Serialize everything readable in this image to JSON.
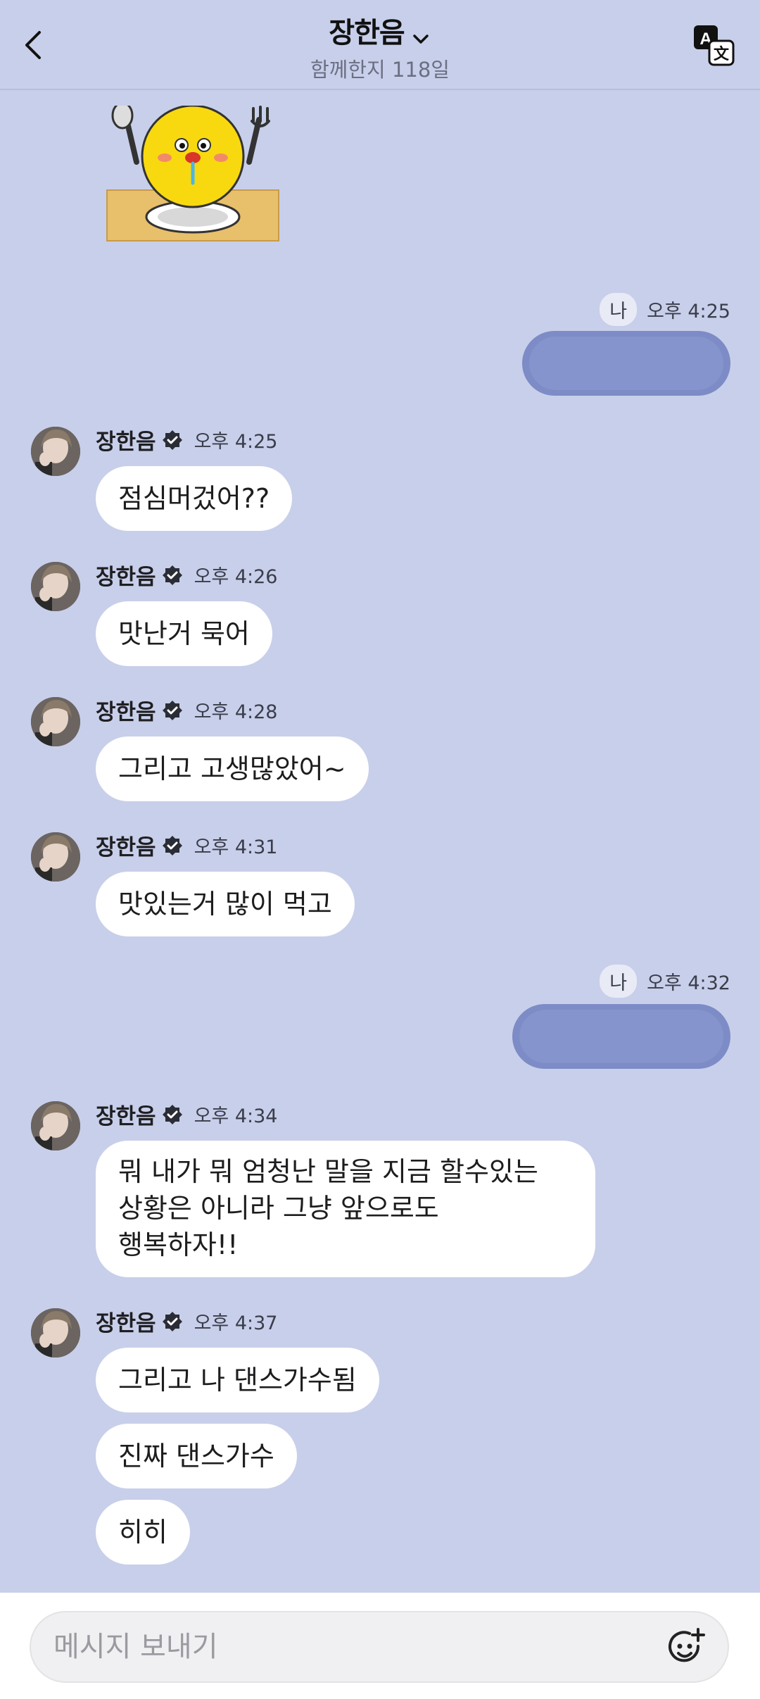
{
  "header": {
    "title": "장한음",
    "subtitle": "함께한지 118일"
  },
  "sticker": {
    "name": "hungry-chick-sticker"
  },
  "my_messages": [
    {
      "badge": "나",
      "time": "오후 4:25",
      "content": "hidden"
    },
    {
      "badge": "나",
      "time": "오후 4:32",
      "content": "hidden"
    }
  ],
  "incoming": [
    {
      "sender": "장한음",
      "time": "오후 4:25",
      "bubbles": [
        "점심머겄어??"
      ]
    },
    {
      "sender": "장한음",
      "time": "오후 4:26",
      "bubbles": [
        "맛난거 묵어"
      ]
    },
    {
      "sender": "장한음",
      "time": "오후 4:28",
      "bubbles": [
        "그리고 고생많았어~"
      ]
    },
    {
      "sender": "장한음",
      "time": "오후 4:31",
      "bubbles": [
        "맛있는거 많이 먹고"
      ]
    },
    {
      "sender": "장한음",
      "time": "오후 4:34",
      "lines": [
        "뭐 내가 뭐 엄청난 말을 지금 할수있는",
        "상황은 아니라 그냥 앞으로도",
        "행복하자!!"
      ]
    },
    {
      "sender": "장한음",
      "time": "오후 4:37",
      "bubbles": [
        "그리고 나 댄스가수됨",
        "진짜 댄스가수",
        "히히"
      ]
    }
  ],
  "input": {
    "placeholder": "메시지 보내기"
  },
  "colors": {
    "background": "#c8cfea",
    "bubble": "#ffffff",
    "my_bubble": "#7d8bc6"
  }
}
